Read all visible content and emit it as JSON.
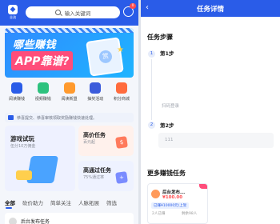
{
  "left": {
    "logo_text": "业流",
    "search_placeholder": "输入关键词",
    "message_badge": "0",
    "banner": {
      "line1": "哪些赚钱",
      "line2": "APP靠谱?",
      "coin": "赏"
    },
    "icons": [
      {
        "label": "阅读赚钱",
        "icon": "book-icon",
        "color": "#2a5ce8"
      },
      {
        "label": "视频赚钱",
        "icon": "video-icon",
        "color": "#2ec27e"
      },
      {
        "label": "阅读新盟",
        "icon": "gift-icon",
        "color": "#ff9a2e"
      },
      {
        "label": "抽奖活动",
        "icon": "lottery-icon",
        "color": "#3b5bdb"
      },
      {
        "label": "积分商城",
        "icon": "shop-icon",
        "color": "#ff6b3d"
      }
    ],
    "notice": "恭喜提交、恭喜审核领取奖励赚钱快速处理。",
    "card_game": {
      "title": "游戏试玩",
      "sub": "伍分10万佣金"
    },
    "card_high": {
      "title": "高价任务",
      "sub": "百元起",
      "badge_icon": "dollar-icon",
      "badge_text": "$"
    },
    "card_pass": {
      "title": "高通过任务",
      "sub": "75%通过率",
      "badge_icon": "plus-icon",
      "badge_text": "+"
    },
    "tabs": [
      "全部",
      "砍价助力",
      "简单关注",
      "人脉拓展",
      "筛选"
    ],
    "list_item_name": "后台发布任务"
  },
  "right": {
    "title": "任务详情",
    "section_steps": "任务步骤",
    "steps": [
      {
        "num": "1",
        "name": "第1步",
        "desc": "扫码登录"
      },
      {
        "num": "2",
        "name": "第2步",
        "input_value": "111"
      }
    ],
    "section_more": "更多赚钱任务",
    "task_card": {
      "title": "后台发布...",
      "price": "¥100.00",
      "tag": "已赚¥10000元/上架",
      "meta_left": "2人已赚",
      "meta_right": "剩余98人"
    }
  }
}
